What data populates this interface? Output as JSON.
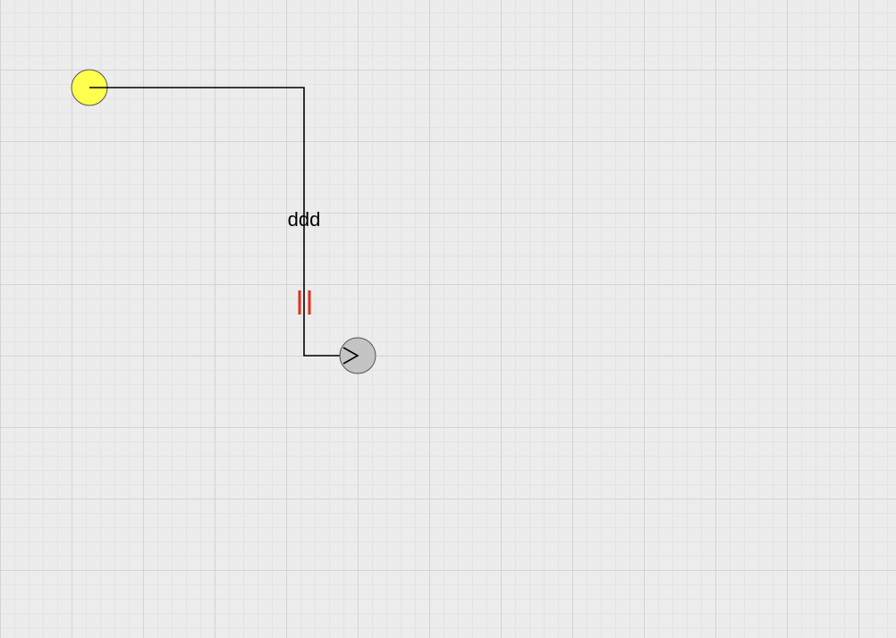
{
  "colors": {
    "canvas_background": "#ececec",
    "grid_major": "#d3d3d3",
    "grid_minor": "#e3e3e3",
    "edge_stroke": "#000000",
    "source_node_fill": "#ffff4d",
    "target_node_fill": "#c4c4c4",
    "node_stroke": "#555555",
    "marker_color": "#e0301e"
  },
  "diagram": {
    "nodes": [
      {
        "id": "source",
        "shape": "circle"
      },
      {
        "id": "target",
        "shape": "circle"
      }
    ],
    "edge": {
      "from": "source",
      "to": "target",
      "label": "ddd",
      "routing": "orthogonal",
      "end_arrow": "open-arrow",
      "midpoint_marker": "double-bar"
    }
  }
}
